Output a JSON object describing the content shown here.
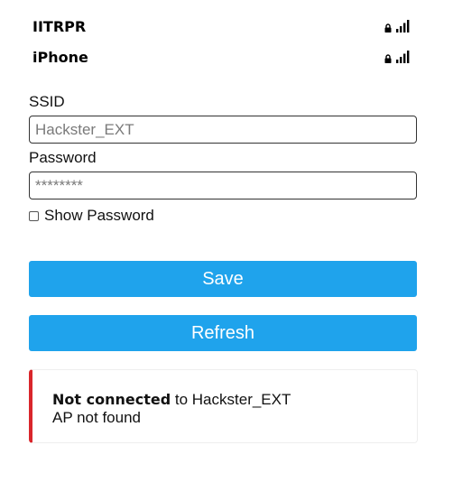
{
  "networks": [
    {
      "ssid": "IITRPR",
      "secured": true,
      "signal_icon": "signal-4-bars-icon",
      "lock_icon": "lock-icon"
    },
    {
      "ssid": "iPhone",
      "secured": true,
      "signal_icon": "signal-4-bars-icon",
      "lock_icon": "lock-icon"
    }
  ],
  "form": {
    "ssid_label": "SSID",
    "ssid_value": "",
    "ssid_placeholder": "Hackster_EXT",
    "password_label": "Password",
    "password_value": "",
    "password_placeholder": "********",
    "show_password_label": "Show Password",
    "show_password_checked": false
  },
  "buttons": {
    "save_label": "Save",
    "refresh_label": "Refresh"
  },
  "status": {
    "state_text": "Not connected",
    "connector_text": " to ",
    "target_ssid": "Hackster_EXT",
    "detail_text": "AP not found"
  },
  "colors": {
    "button_bg": "#1fa3ec",
    "button_text": "#ffffff",
    "status_error_accent": "#d9262b"
  }
}
